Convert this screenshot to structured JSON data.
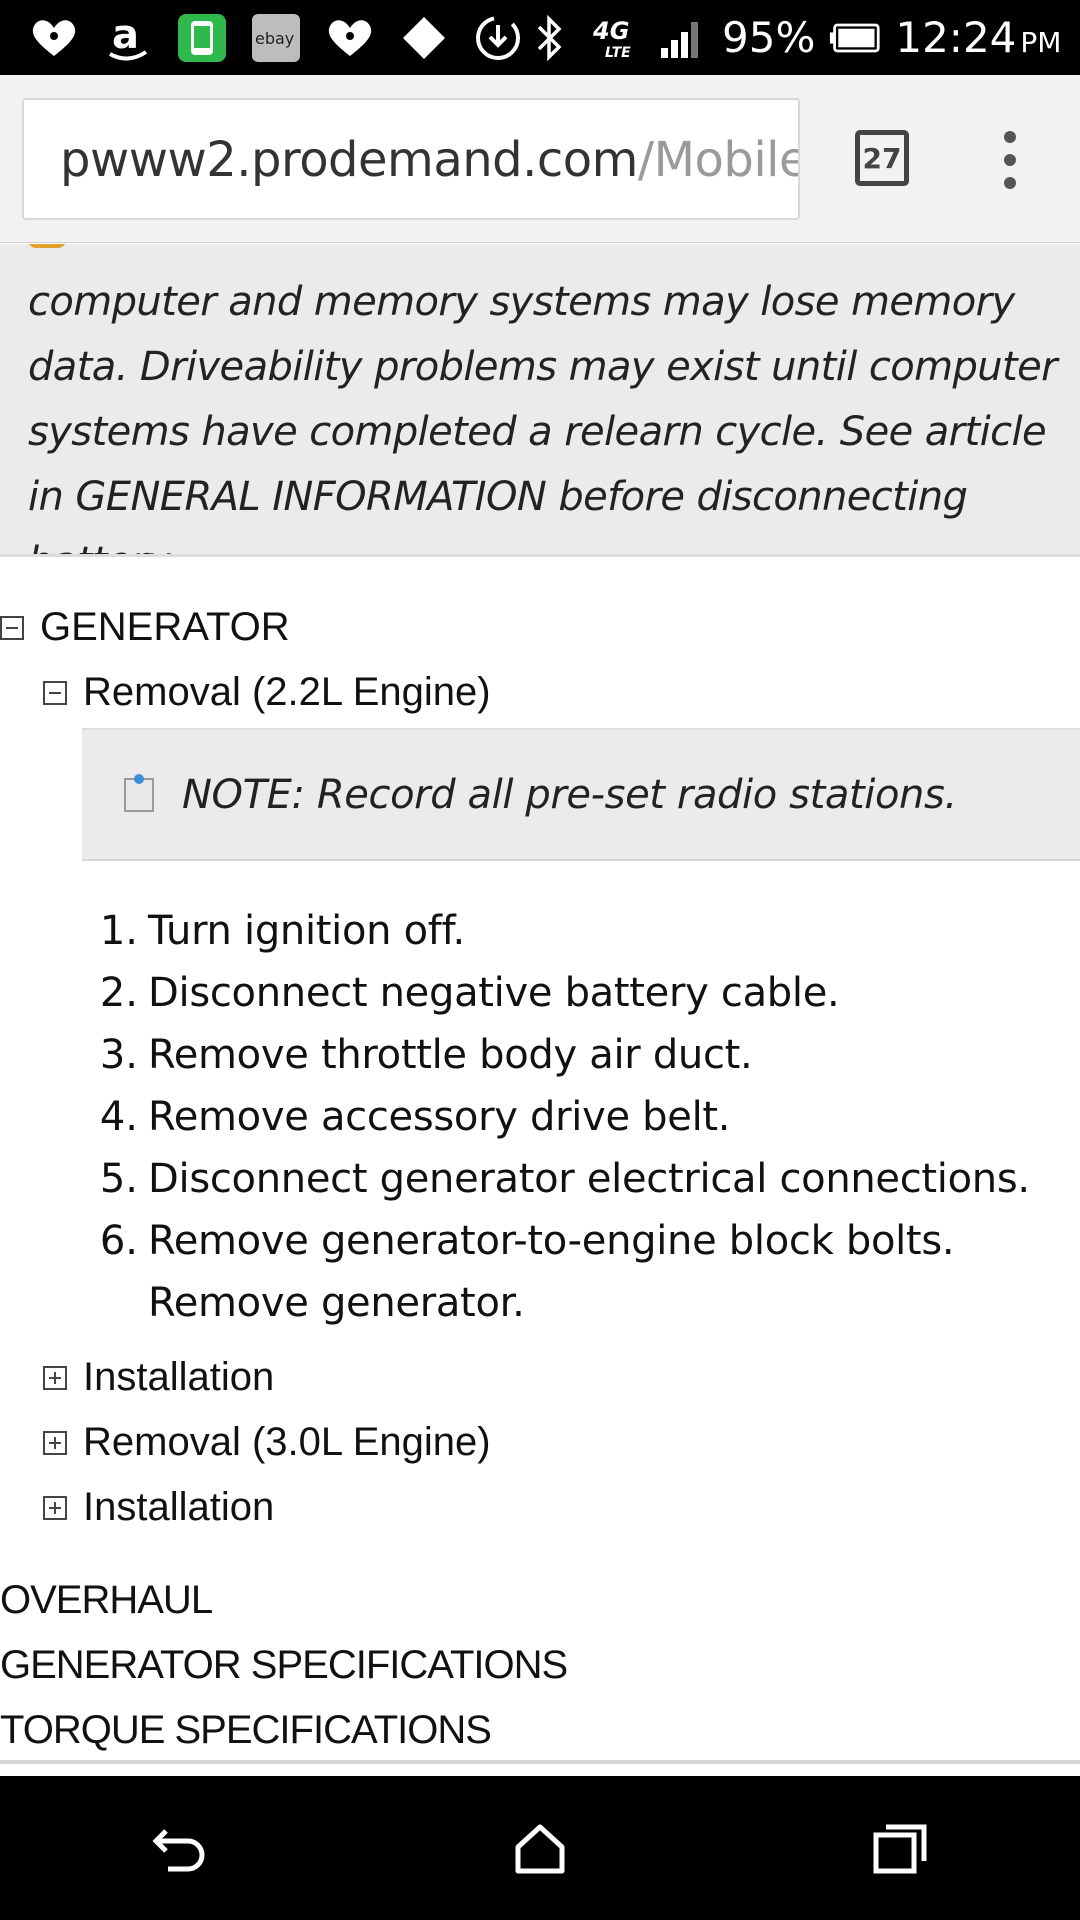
{
  "status_bar": {
    "notification_icons": [
      "iheartradio-icon",
      "amazon-icon",
      "phone-app-icon",
      "ebay-icon",
      "iheartradio-icon",
      "diamond-icon",
      "download-icon"
    ],
    "ebay_label": "ebay",
    "network": "4G LTE",
    "battery_percent": "95%",
    "time": "12:24",
    "ampm": "PM"
  },
  "browser": {
    "url_host": "pwww2.prodemand.com",
    "url_path": "/Mobile/",
    "tab_count": "27"
  },
  "caution": {
    "text": "computer and memory systems may lose memory data. Driveability problems may exist until computer systems have completed a relearn cycle. See article in GENERAL INFORMATION before disconnecting battery."
  },
  "tree": {
    "generator": "GENERATOR",
    "removal_22": "Removal (2.2L Engine)",
    "note": "NOTE: Record all pre-set radio stations.",
    "steps": [
      "Turn ignition off.",
      "Disconnect negative battery cable.",
      "Remove throttle body air duct.",
      "Remove accessory drive belt.",
      "Disconnect generator electrical connections.",
      "Remove generator-to-engine block bolts. Remove generator."
    ],
    "step_numbers": [
      "1.",
      "2.",
      "3.",
      "4.",
      "5.",
      "6."
    ],
    "installation_1": "Installation",
    "removal_30": "Removal (3.0L Engine)",
    "installation_2": "Installation",
    "overhaul": "OVERHAUL",
    "generator_specs": "GENERATOR SPECIFICATIONS",
    "torque_specs": "TORQUE SPECIFICATIONS"
  },
  "nav_bar": {
    "icons": [
      "back-icon",
      "home-icon",
      "recents-icon"
    ]
  }
}
